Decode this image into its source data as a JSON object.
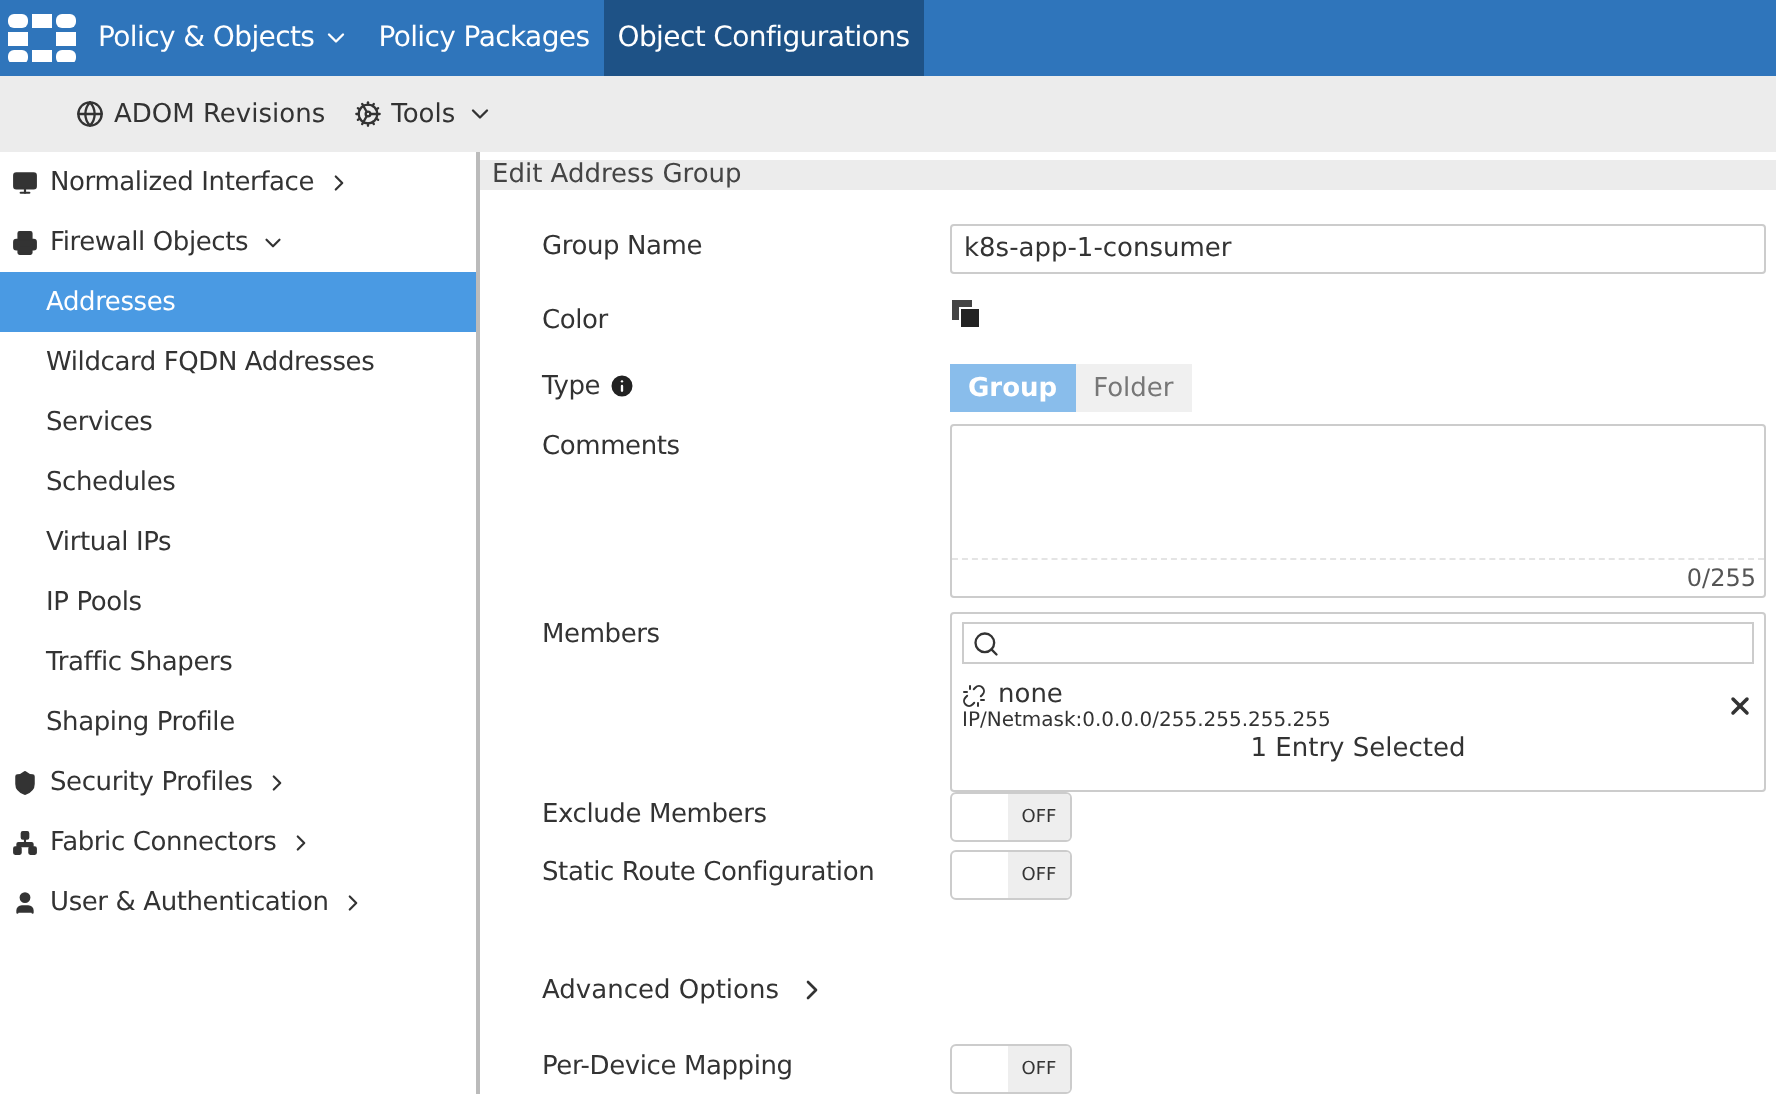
{
  "nav": {
    "tabs": [
      {
        "label": "Policy & Objects",
        "selected": false,
        "caret": true
      },
      {
        "label": "Policy Packages",
        "selected": false,
        "caret": false
      },
      {
        "label": "Object Configurations",
        "selected": true,
        "caret": false
      }
    ]
  },
  "toolbar": [
    {
      "label": "ADOM Revisions",
      "caret": false
    },
    {
      "label": "Tools",
      "caret": true
    }
  ],
  "sidebar": [
    {
      "label": "Normalized Interface",
      "expanded": false
    },
    {
      "label": "Firewall Objects",
      "expanded": true,
      "children": [
        {
          "label": "Addresses",
          "selected": true
        },
        {
          "label": "Wildcard FQDN Addresses",
          "selected": false
        },
        {
          "label": "Services",
          "selected": false
        },
        {
          "label": "Schedules",
          "selected": false
        },
        {
          "label": "Virtual IPs",
          "selected": false
        },
        {
          "label": "IP Pools",
          "selected": false
        },
        {
          "label": "Traffic Shapers",
          "selected": false
        },
        {
          "label": "Shaping Profile",
          "selected": false
        }
      ]
    },
    {
      "label": "Security Profiles",
      "expanded": false
    },
    {
      "label": "Fabric Connectors",
      "expanded": false
    },
    {
      "label": "User & Authentication",
      "expanded": false
    }
  ],
  "form": {
    "title": "Edit Address Group",
    "fields": [
      {
        "kind": "text",
        "label": "Group Name",
        "value": "k8s-app-1-consumer"
      },
      {
        "kind": "color",
        "label": "Color"
      },
      {
        "kind": "segmented",
        "label": "Type",
        "info": true,
        "options": [
          {
            "label": "Group",
            "selected": true
          },
          {
            "label": "Folder",
            "selected": false
          }
        ]
      },
      {
        "kind": "textarea",
        "label": "Comments",
        "counter": "0/255"
      },
      {
        "kind": "members",
        "label": "Members",
        "entries": [
          {
            "name": "none",
            "detail": "IP/Netmask:0.0.0.0/255.255.255.255"
          }
        ],
        "footer": "1 Entry Selected"
      },
      {
        "kind": "toggle",
        "label": "Exclude Members",
        "on": false,
        "state_label": "OFF"
      },
      {
        "kind": "toggle",
        "label": "Static Route Configuration",
        "on": false,
        "state_label": "OFF"
      },
      {
        "kind": "expander",
        "label": "Advanced Options"
      },
      {
        "kind": "toggle",
        "label": "Per-Device Mapping",
        "on": false,
        "state_label": "OFF"
      }
    ]
  }
}
